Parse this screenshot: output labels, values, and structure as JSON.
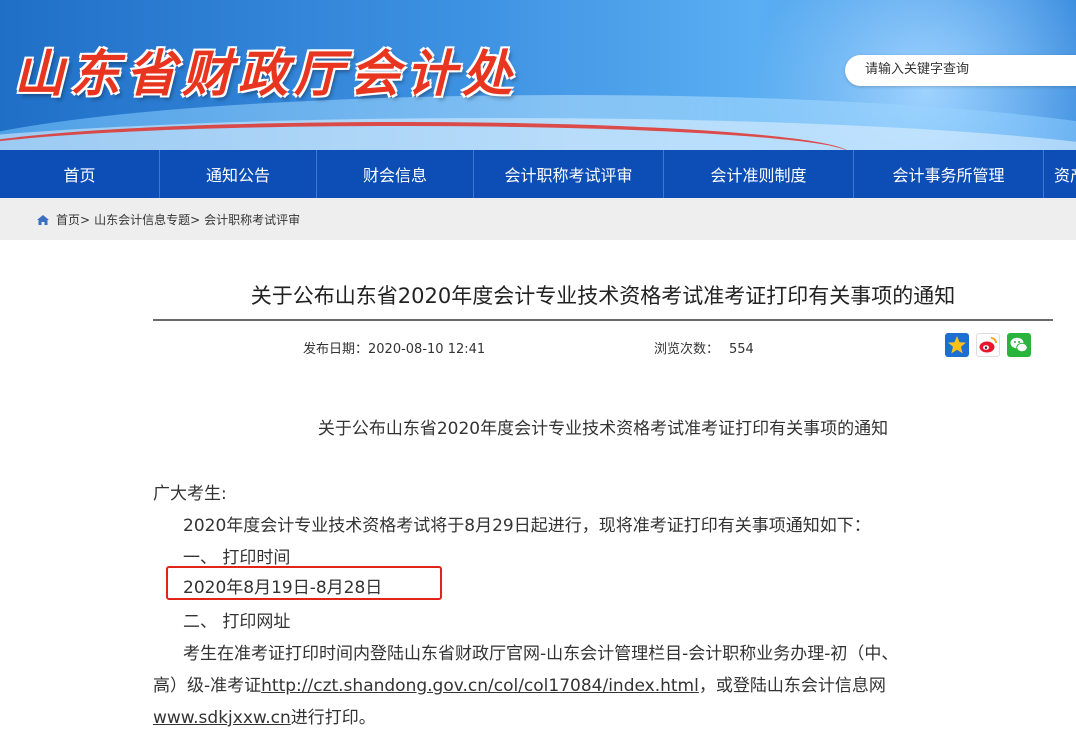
{
  "site": {
    "title": "山东省财政厅会计处",
    "search_placeholder": "请输入关键字查询"
  },
  "nav": {
    "items": [
      "首页",
      "通知公告",
      "财会信息",
      "会计职称考试评审",
      "会计准则制度",
      "会计事务所管理",
      "资产评估"
    ]
  },
  "breadcrumb": {
    "items": [
      "首页",
      "山东会计信息专题",
      "会计职称考试评审"
    ],
    "separator": ">"
  },
  "article": {
    "title": "关于公布山东省2020年度会计专业技术资格考试准考证打印有关事项的通知",
    "publish_label": "发布日期：",
    "publish_date": "2020-08-10 12:41",
    "views_label": "浏览次数：",
    "views": "554",
    "subtitle": "关于公布山东省2020年度会计专业技术资格考试准考证打印有关事项的通知",
    "greeting": "广大考生:",
    "intro": "2020年度会计专业技术资格考试将于8月29日起进行，现将准考证打印有关事项通知如下：",
    "section1_heading": "一、 打印时间",
    "section1_value": "2020年8月19日-8月28日",
    "section2_heading": "二、 打印网址",
    "section2_line1": "考生在准考证打印时间内登陆山东省财政厅官网-山东会计管理栏目-会计职称业务办理-初（中、",
    "section2_line2_prefix": "高）级-准考证",
    "section2_link1": "http://czt.shandong.gov.cn/col/col17084/index.html",
    "section2_line2_suffix": "，或登陆山东会计信息网",
    "section2_link2": "www.sdkjxxw.cn",
    "section2_line3_suffix": "进行打印。"
  },
  "colors": {
    "nav_bg": "#0d4eb6",
    "title_red": "#e8351f",
    "highlight_red": "#e0241a"
  },
  "icons": [
    "home-icon",
    "favorite-star-icon",
    "weibo-icon",
    "wechat-icon"
  ]
}
